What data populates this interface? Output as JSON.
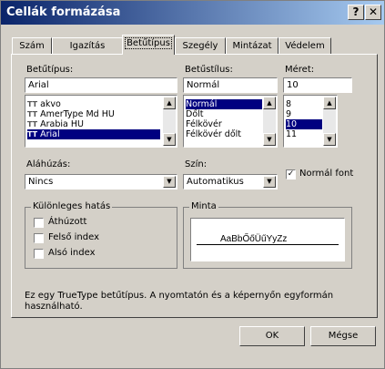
{
  "window": {
    "title": "Cellák formázása",
    "help_button": "?",
    "close_button": "✕"
  },
  "tabs": [
    {
      "label": "Szám",
      "active": false
    },
    {
      "label": "Igazítás",
      "active": false
    },
    {
      "label": "Betűtípus",
      "active": true
    },
    {
      "label": "Szegély",
      "active": false
    },
    {
      "label": "Mintázat",
      "active": false
    },
    {
      "label": "Védelem",
      "active": false
    }
  ],
  "font": {
    "label": "Betűtípus:",
    "value": "Arial",
    "items": [
      {
        "label": "akvo",
        "selected": false
      },
      {
        "label": "AmerType Md HU",
        "selected": false
      },
      {
        "label": "Arabia HU",
        "selected": false
      },
      {
        "label": "Arial",
        "selected": true
      }
    ]
  },
  "style": {
    "label": "Betűstílus:",
    "value": "Normál",
    "items": [
      {
        "label": "Normál",
        "selected": true
      },
      {
        "label": "Dőlt",
        "selected": false
      },
      {
        "label": "Félkövér",
        "selected": false
      },
      {
        "label": "Félkövér dőlt",
        "selected": false
      }
    ]
  },
  "size": {
    "label": "Méret:",
    "value": "10",
    "items": [
      {
        "label": "8",
        "selected": false
      },
      {
        "label": "9",
        "selected": false
      },
      {
        "label": "10",
        "selected": true
      },
      {
        "label": "11",
        "selected": false
      }
    ]
  },
  "underline": {
    "label": "Aláhúzás:",
    "value": "Nincs"
  },
  "color": {
    "label": "Szín:",
    "value": "Automatikus"
  },
  "normal_font": {
    "label": "Normál font",
    "checked": true
  },
  "effects": {
    "title": "Különleges hatás",
    "items": [
      {
        "label": "Áthúzott",
        "checked": false
      },
      {
        "label": "Felső index",
        "checked": false
      },
      {
        "label": "Alsó index",
        "checked": false
      }
    ]
  },
  "preview": {
    "title": "Minta",
    "text": "AaBbŐőÜűYyZz"
  },
  "description": "Ez egy TrueType betűtípus. A nyomtatón és a képernyőn egyformán használható.",
  "buttons": {
    "ok": "OK",
    "cancel": "Mégse"
  },
  "icons": {
    "truetype": "TT"
  }
}
